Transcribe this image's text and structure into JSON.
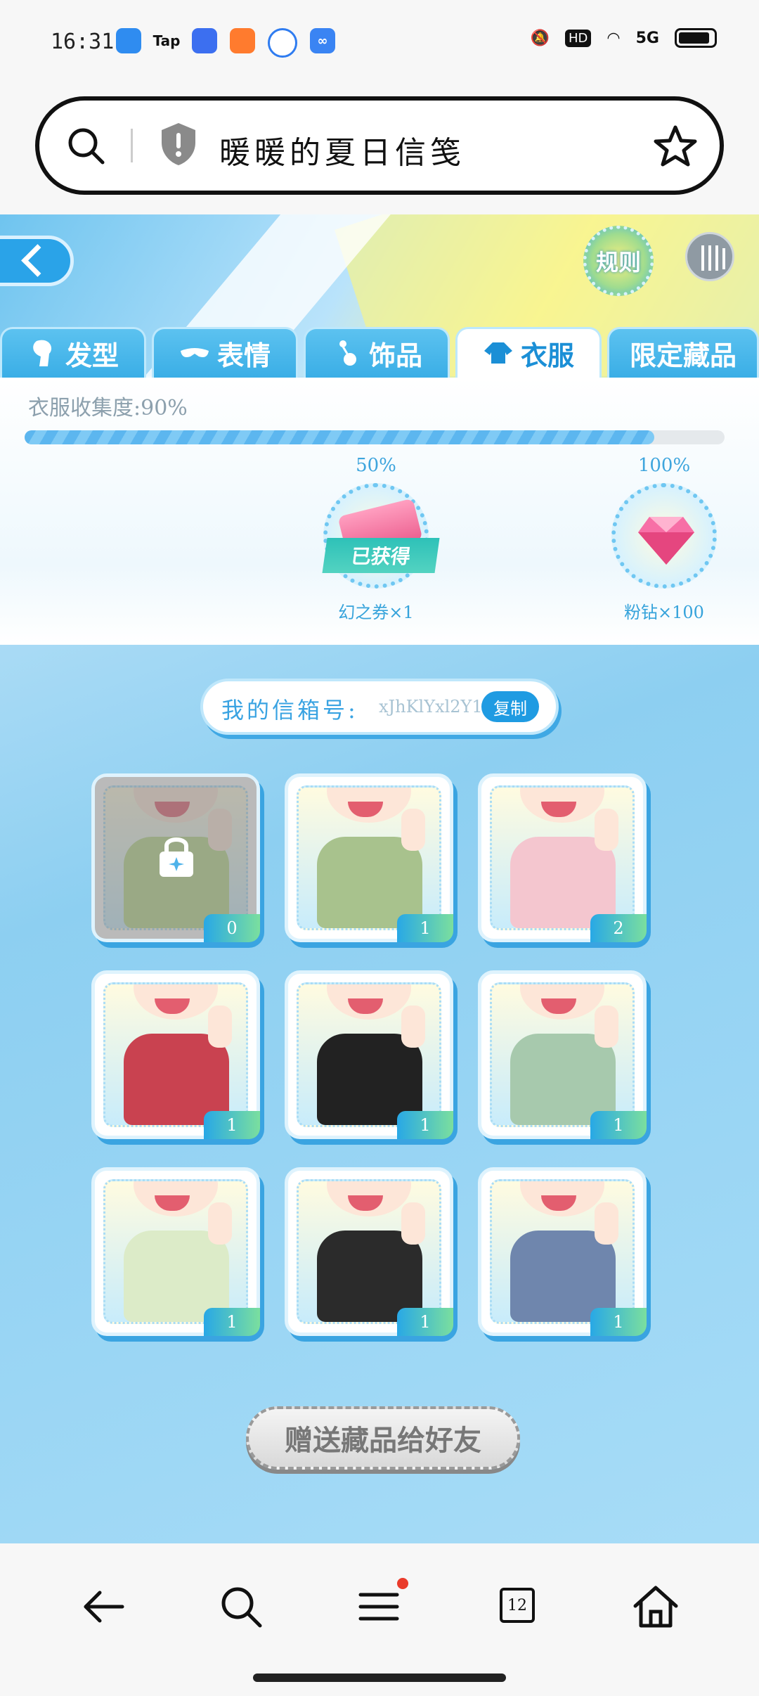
{
  "status": {
    "time": "16:31",
    "apps": [
      "Tap"
    ],
    "network": "5G",
    "hd": "HD"
  },
  "browser": {
    "search_text": "暖暖的夏日信笺"
  },
  "tabs": [
    {
      "label": "发型",
      "active": false
    },
    {
      "label": "表情",
      "active": false
    },
    {
      "label": "饰品",
      "active": false
    },
    {
      "label": "衣服",
      "active": true
    },
    {
      "label": "限定藏品",
      "active": false
    }
  ],
  "header": {
    "rules_label": "规则"
  },
  "collection": {
    "label": "衣服收集度:90%",
    "progress_percent": 90,
    "milestones": [
      {
        "pct": "50%",
        "reward": "幻之券×1",
        "status": "已获得"
      },
      {
        "pct": "100%",
        "reward": "粉钻×100"
      }
    ]
  },
  "mailbox": {
    "label": "我的信箱号:",
    "value": "xJhKlYxl2Y19",
    "copy_label": "复制"
  },
  "items": [
    {
      "count": "0",
      "locked": true,
      "color": "#b8d98b"
    },
    {
      "count": "1",
      "locked": false,
      "color": "#a8c28d"
    },
    {
      "count": "2",
      "locked": false,
      "color": "#f4c6cf"
    },
    {
      "count": "1",
      "locked": false,
      "color": "#c94250"
    },
    {
      "count": "1",
      "locked": false,
      "color": "#222222"
    },
    {
      "count": "1",
      "locked": false,
      "color": "#a7c9ad"
    },
    {
      "count": "1",
      "locked": false,
      "color": "#dcebc8"
    },
    {
      "count": "1",
      "locked": false,
      "color": "#2b2b2b"
    },
    {
      "count": "1",
      "locked": false,
      "color": "#6f86ad"
    }
  ],
  "gift_button": "赠送藏品给好友",
  "nav": {
    "tab_count": "12"
  }
}
